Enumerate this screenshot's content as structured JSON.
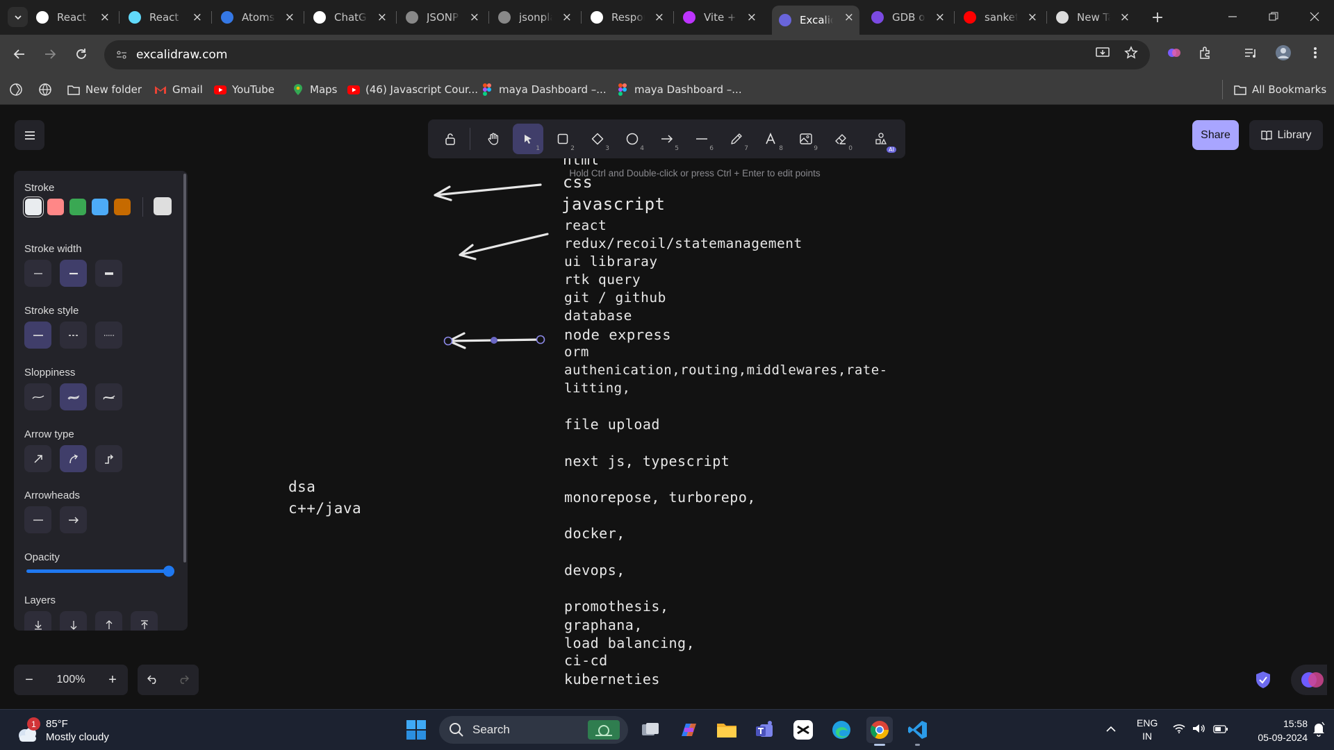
{
  "browser": {
    "tabs": [
      {
        "title": "React (",
        "icon": "chatgpt-icon",
        "color": "#ffffff"
      },
      {
        "title": "React /",
        "icon": "react-icon",
        "color": "#61dafb"
      },
      {
        "title": "Atoms",
        "icon": "recoil-icon",
        "color": "#3578e5"
      },
      {
        "title": "ChatGP",
        "icon": "chatgpt-icon",
        "color": "#ffffff"
      },
      {
        "title": "JSONP",
        "icon": "json-icon",
        "color": "#888888"
      },
      {
        "title": "jsonpla",
        "icon": "json-icon",
        "color": "#888888"
      },
      {
        "title": "Respon",
        "icon": "doc-icon",
        "color": "#ffffff"
      },
      {
        "title": "Vite +",
        "icon": "vite-icon",
        "color": "#bd34fe"
      },
      {
        "title": "Excalid",
        "icon": "excalidraw-icon",
        "color": "#6965db"
      },
      {
        "title": "GDB o",
        "icon": "gdb-icon",
        "color": "#7b4ae2"
      },
      {
        "title": "sanket",
        "icon": "youtube-icon",
        "color": "#ff0000"
      },
      {
        "title": "New Ta",
        "icon": "chrome-icon",
        "color": "#dddddd"
      }
    ],
    "active_tab_index": 8,
    "url": "excalidraw.com",
    "bookmarks": [
      {
        "label": "New folder",
        "icon": "folder-icon"
      },
      {
        "label": "Gmail",
        "icon": "gmail-icon"
      },
      {
        "label": "YouTube",
        "icon": "youtube-icon"
      },
      {
        "label": "Maps",
        "icon": "maps-icon"
      },
      {
        "label": "(46) Javascript Cour...",
        "icon": "youtube-icon"
      },
      {
        "label": "maya Dashboard –...",
        "icon": "figma-icon"
      },
      {
        "label": "maya Dashboard –...",
        "icon": "figma-icon"
      }
    ],
    "all_bookmarks": "All Bookmarks"
  },
  "excalidraw": {
    "hint": "Hold Ctrl and Double-click or press Ctrl + Enter to edit points",
    "share": "Share",
    "library": "Library",
    "tool_keys": [
      "",
      "",
      "1",
      "2",
      "3",
      "4",
      "5",
      "6",
      "7",
      "8",
      "9",
      "0"
    ],
    "ai_label": "AI",
    "panel": {
      "stroke": "Stroke",
      "stroke_width": "Stroke width",
      "stroke_style": "Stroke style",
      "sloppiness": "Sloppiness",
      "arrow_type": "Arrow type",
      "arrowheads": "Arrowheads",
      "opacity": "Opacity",
      "layers": "Layers",
      "stroke_colors": [
        "#e9ecef",
        "#ff8787",
        "#3aa853",
        "#4dabf7",
        "#c66a00"
      ],
      "current_color": "#dedede",
      "opacity_value": 100
    },
    "zoom": "100%",
    "canvas_text": {
      "list": [
        "html",
        "css",
        "javascript",
        "react",
        "redux/recoil/statemanagement",
        "ui libraray",
        "rtk query",
        "git / github",
        "database",
        "node express",
        "orm",
        "authenication,routing,middlewares,rate-",
        "litting,",
        "file upload",
        "next js, typescript",
        "monorepose, turborepo,",
        "docker,",
        "devops,",
        "promothesis,",
        "graphana,",
        "load balancing,",
        "ci-cd",
        "kuberneties"
      ],
      "side": [
        "dsa",
        "c++/java"
      ]
    }
  },
  "taskbar": {
    "weather_temp": "85°F",
    "weather_desc": "Mostly cloudy",
    "weather_badge": "1",
    "search": "Search",
    "lang": "ENG",
    "region": "IN",
    "time": "15:58",
    "date": "05-09-2024"
  }
}
